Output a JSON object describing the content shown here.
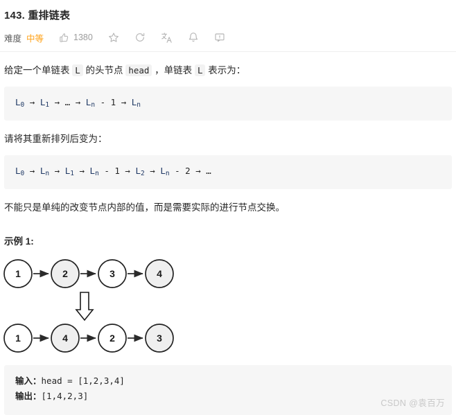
{
  "header": {
    "title": "143. 重排链表",
    "difficulty_label": "难度",
    "difficulty_value": "中等",
    "difficulty_color": "#FFA116",
    "likes_count": "1380",
    "icons": {
      "thumbs_up": "thumbs-up-icon",
      "star": "star-icon",
      "refresh": "refresh-icon",
      "translate": "translate-icon",
      "bell": "bell-icon",
      "comment": "comment-icon"
    }
  },
  "content": {
    "para1_part1": "给定一个单链表 ",
    "para1_code1": "L",
    "para1_part2": " 的头节点 ",
    "para1_code2": "head",
    "para1_part3": " ，单链表 ",
    "para1_code3": "L",
    "para1_part4": " 表示为：",
    "code1_plain": "L0 → L1 → … → Ln - 1 → Ln",
    "para2": "请将其重新排列后变为：",
    "code2_plain": "L0 → Ln → L1 → Ln - 1 → L2 → Ln - 2 → …",
    "para3": "不能只是单纯的改变节点内部的值，而是需要实际的进行节点交换。",
    "example_head": "示例 1:"
  },
  "diagram": {
    "row1": [
      {
        "value": "1",
        "filled": false
      },
      {
        "value": "2",
        "filled": true
      },
      {
        "value": "3",
        "filled": false
      },
      {
        "value": "4",
        "filled": true
      }
    ],
    "row2": [
      {
        "value": "1",
        "filled": false
      },
      {
        "value": "4",
        "filled": true
      },
      {
        "value": "2",
        "filled": false
      },
      {
        "value": "3",
        "filled": true
      }
    ],
    "transform_arrow": "down-arrow-icon",
    "node_fill": "#efefef",
    "node_stroke": "#222222"
  },
  "io": {
    "input_label": "输入：",
    "input_value": "head = [1,2,3,4]",
    "output_label": "输出：",
    "output_value": "[1,4,2,3]"
  },
  "watermark": "CSDN @袁百万"
}
